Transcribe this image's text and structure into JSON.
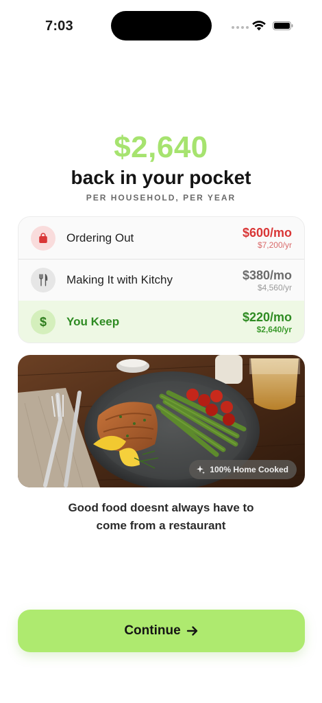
{
  "status_bar": {
    "time": "7:03"
  },
  "hero": {
    "amount": "$2,640",
    "headline": "back in your pocket",
    "subhead": "PER HOUSEHOLD, PER YEAR"
  },
  "comparison": {
    "rows": [
      {
        "icon": "shopping-bag-icon",
        "label": "Ordering Out",
        "monthly": "$600/mo",
        "yearly": "$7,200/yr",
        "color": "#d93636"
      },
      {
        "icon": "fork-knife-icon",
        "label": "Making It with Kitchy",
        "monthly": "$380/mo",
        "yearly": "$4,560/yr",
        "color": "#6b6b6b"
      },
      {
        "icon": "dollar-icon",
        "icon_text": "$",
        "label": "You Keep",
        "monthly": "$220/mo",
        "yearly": "$2,640/yr",
        "color": "#2e8b22"
      }
    ]
  },
  "food_image": {
    "badge": "100% Home Cooked",
    "badge_icon": "sparkle-icon"
  },
  "caption": {
    "line1": "Good food doesnt always have to",
    "line2": "come from a restaurant"
  },
  "cta": {
    "label": "Continue",
    "icon": "arrow-right-icon",
    "color": "#aeea6f"
  },
  "colors": {
    "accent": "#a6e36f",
    "negative": "#d93636",
    "positive": "#2e8b22"
  }
}
